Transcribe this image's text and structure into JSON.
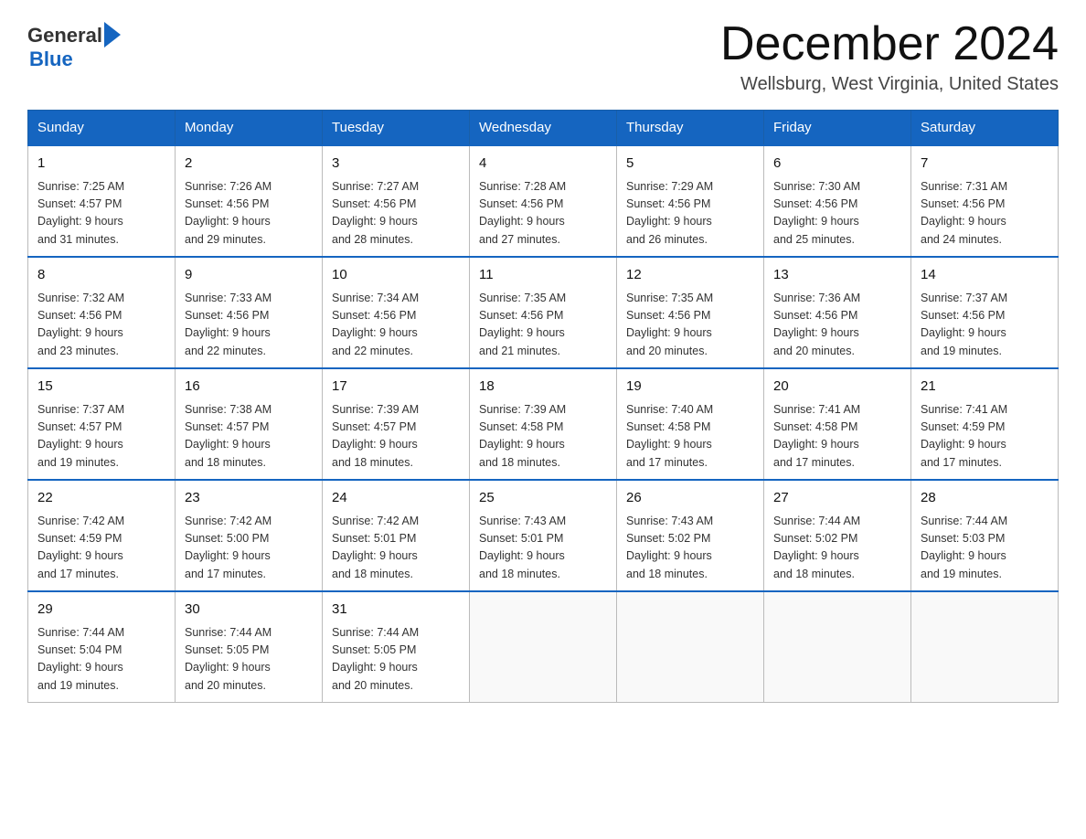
{
  "header": {
    "logo_general": "General",
    "logo_blue": "Blue",
    "month_title": "December 2024",
    "location": "Wellsburg, West Virginia, United States"
  },
  "days_of_week": [
    "Sunday",
    "Monday",
    "Tuesday",
    "Wednesday",
    "Thursday",
    "Friday",
    "Saturday"
  ],
  "weeks": [
    [
      {
        "day": 1,
        "sunrise": "7:25 AM",
        "sunset": "4:57 PM",
        "daylight": "9 hours and 31 minutes."
      },
      {
        "day": 2,
        "sunrise": "7:26 AM",
        "sunset": "4:56 PM",
        "daylight": "9 hours and 29 minutes."
      },
      {
        "day": 3,
        "sunrise": "7:27 AM",
        "sunset": "4:56 PM",
        "daylight": "9 hours and 28 minutes."
      },
      {
        "day": 4,
        "sunrise": "7:28 AM",
        "sunset": "4:56 PM",
        "daylight": "9 hours and 27 minutes."
      },
      {
        "day": 5,
        "sunrise": "7:29 AM",
        "sunset": "4:56 PM",
        "daylight": "9 hours and 26 minutes."
      },
      {
        "day": 6,
        "sunrise": "7:30 AM",
        "sunset": "4:56 PM",
        "daylight": "9 hours and 25 minutes."
      },
      {
        "day": 7,
        "sunrise": "7:31 AM",
        "sunset": "4:56 PM",
        "daylight": "9 hours and 24 minutes."
      }
    ],
    [
      {
        "day": 8,
        "sunrise": "7:32 AM",
        "sunset": "4:56 PM",
        "daylight": "9 hours and 23 minutes."
      },
      {
        "day": 9,
        "sunrise": "7:33 AM",
        "sunset": "4:56 PM",
        "daylight": "9 hours and 22 minutes."
      },
      {
        "day": 10,
        "sunrise": "7:34 AM",
        "sunset": "4:56 PM",
        "daylight": "9 hours and 22 minutes."
      },
      {
        "day": 11,
        "sunrise": "7:35 AM",
        "sunset": "4:56 PM",
        "daylight": "9 hours and 21 minutes."
      },
      {
        "day": 12,
        "sunrise": "7:35 AM",
        "sunset": "4:56 PM",
        "daylight": "9 hours and 20 minutes."
      },
      {
        "day": 13,
        "sunrise": "7:36 AM",
        "sunset": "4:56 PM",
        "daylight": "9 hours and 20 minutes."
      },
      {
        "day": 14,
        "sunrise": "7:37 AM",
        "sunset": "4:56 PM",
        "daylight": "9 hours and 19 minutes."
      }
    ],
    [
      {
        "day": 15,
        "sunrise": "7:37 AM",
        "sunset": "4:57 PM",
        "daylight": "9 hours and 19 minutes."
      },
      {
        "day": 16,
        "sunrise": "7:38 AM",
        "sunset": "4:57 PM",
        "daylight": "9 hours and 18 minutes."
      },
      {
        "day": 17,
        "sunrise": "7:39 AM",
        "sunset": "4:57 PM",
        "daylight": "9 hours and 18 minutes."
      },
      {
        "day": 18,
        "sunrise": "7:39 AM",
        "sunset": "4:58 PM",
        "daylight": "9 hours and 18 minutes."
      },
      {
        "day": 19,
        "sunrise": "7:40 AM",
        "sunset": "4:58 PM",
        "daylight": "9 hours and 17 minutes."
      },
      {
        "day": 20,
        "sunrise": "7:41 AM",
        "sunset": "4:58 PM",
        "daylight": "9 hours and 17 minutes."
      },
      {
        "day": 21,
        "sunrise": "7:41 AM",
        "sunset": "4:59 PM",
        "daylight": "9 hours and 17 minutes."
      }
    ],
    [
      {
        "day": 22,
        "sunrise": "7:42 AM",
        "sunset": "4:59 PM",
        "daylight": "9 hours and 17 minutes."
      },
      {
        "day": 23,
        "sunrise": "7:42 AM",
        "sunset": "5:00 PM",
        "daylight": "9 hours and 17 minutes."
      },
      {
        "day": 24,
        "sunrise": "7:42 AM",
        "sunset": "5:01 PM",
        "daylight": "9 hours and 18 minutes."
      },
      {
        "day": 25,
        "sunrise": "7:43 AM",
        "sunset": "5:01 PM",
        "daylight": "9 hours and 18 minutes."
      },
      {
        "day": 26,
        "sunrise": "7:43 AM",
        "sunset": "5:02 PM",
        "daylight": "9 hours and 18 minutes."
      },
      {
        "day": 27,
        "sunrise": "7:44 AM",
        "sunset": "5:02 PM",
        "daylight": "9 hours and 18 minutes."
      },
      {
        "day": 28,
        "sunrise": "7:44 AM",
        "sunset": "5:03 PM",
        "daylight": "9 hours and 19 minutes."
      }
    ],
    [
      {
        "day": 29,
        "sunrise": "7:44 AM",
        "sunset": "5:04 PM",
        "daylight": "9 hours and 19 minutes."
      },
      {
        "day": 30,
        "sunrise": "7:44 AM",
        "sunset": "5:05 PM",
        "daylight": "9 hours and 20 minutes."
      },
      {
        "day": 31,
        "sunrise": "7:44 AM",
        "sunset": "5:05 PM",
        "daylight": "9 hours and 20 minutes."
      },
      null,
      null,
      null,
      null
    ]
  ],
  "labels": {
    "sunrise": "Sunrise:",
    "sunset": "Sunset:",
    "daylight": "Daylight:"
  }
}
